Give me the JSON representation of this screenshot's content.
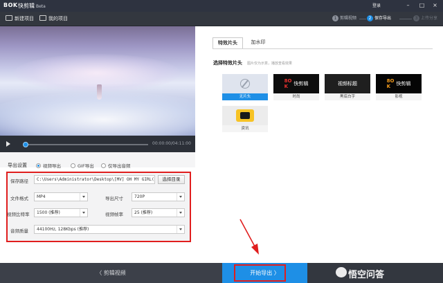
{
  "titlebar": {
    "logo": "BOK",
    "app_name": "快剪辑",
    "badge": "Beta",
    "login": "登录",
    "minimize": "–",
    "maximize": "□",
    "close": "×"
  },
  "toolbar": {
    "new_project": "新建项目",
    "my_projects": "我的项目",
    "steps": [
      {
        "num": "1",
        "label": "剪辑视频"
      },
      {
        "num": "2",
        "label": "保存导出"
      },
      {
        "num": "3",
        "label": "上传分享"
      }
    ]
  },
  "player": {
    "time": "00:00:00/04:11:00"
  },
  "export_settings": {
    "title": "导出设置",
    "modes": [
      "视频导出",
      "GIF导出",
      "仅导出音频"
    ],
    "save_path_label": "保存路径",
    "save_path_value": "C:\\Users\\Administrator\\Desktop\\[MV] OH MY GIRL(...",
    "choose_dir": "选择目录",
    "file_format_label": "文件格式",
    "file_format_value": "MP4",
    "export_size_label": "导出尺寸",
    "export_size_value": "720P",
    "bitrate_label": "视频比特率",
    "bitrate_value": "1500 (推荐)",
    "framerate_label": "视频帧率",
    "framerate_value": "25 (推荐)",
    "audio_quality_label": "音频质量",
    "audio_quality_value": "44100Hz, 128Kbps (推荐)"
  },
  "right_panel": {
    "tabs": [
      "特效片头",
      "加水印"
    ],
    "section_title": "选择特效片头",
    "section_hint": "图片仅为示意，播放查看效果",
    "effects": [
      {
        "caption": "无片头",
        "thumb": ""
      },
      {
        "caption": "时尚",
        "thumb": "快剪辑"
      },
      {
        "caption": "黑底白字",
        "thumb": "视频标题"
      },
      {
        "caption": "影视",
        "thumb": "快剪辑"
      },
      {
        "caption": "资讯",
        "thumb": ""
      }
    ]
  },
  "bottom": {
    "back_label": "〈  剪辑视频",
    "export_label": "开始导出  〉",
    "watermark": "悟空问答"
  },
  "colors": {
    "accent": "#1e8fe6",
    "highlight_red": "#e01d1d",
    "dark_bar": "#33373f"
  }
}
